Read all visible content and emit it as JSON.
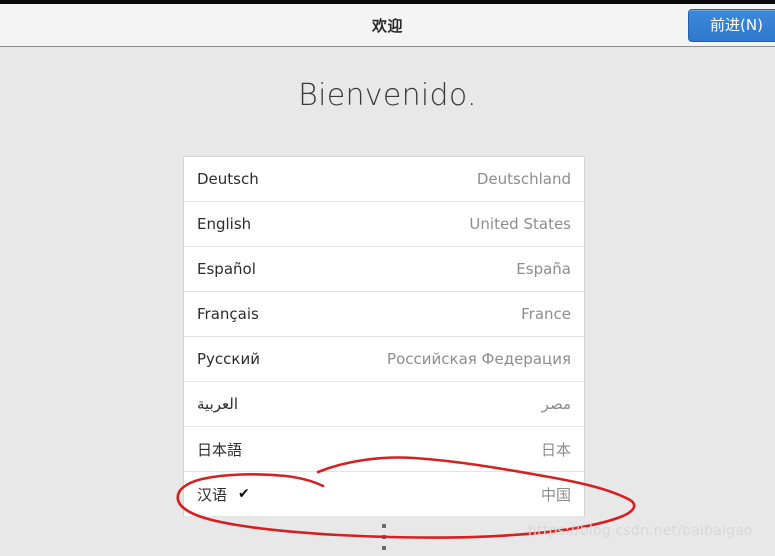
{
  "window": {
    "top_strip_color": "#0a0a0a",
    "background_color": "#e8e8e8"
  },
  "header": {
    "title": "欢迎",
    "next_button_label": "前进(N)",
    "next_button_color": "#3584d6",
    "background_color": "#f4f4f4"
  },
  "main": {
    "welcome_heading": "Bienvenido.",
    "languages": [
      {
        "name": "Deutsch",
        "country": "Deutschland",
        "selected": false
      },
      {
        "name": "English",
        "country": "United States",
        "selected": false
      },
      {
        "name": "Español",
        "country": "España",
        "selected": false
      },
      {
        "name": "Français",
        "country": "France",
        "selected": false
      },
      {
        "name": "Русский",
        "country": "Российская Федерация",
        "selected": false
      },
      {
        "name": "العربية",
        "country": "مصر",
        "selected": false
      },
      {
        "name": "日本語",
        "country": "日本",
        "selected": false
      },
      {
        "name": "汉语",
        "country": "中国",
        "selected": true
      }
    ],
    "check_glyph": "✔",
    "more_handle_name": "more-vertical-dots"
  },
  "annotation": {
    "color": "#d81f1f",
    "shape": "hand-drawn-lasso-oval"
  },
  "watermark": {
    "text": "https://blog.csdn.net/baibaigao"
  }
}
